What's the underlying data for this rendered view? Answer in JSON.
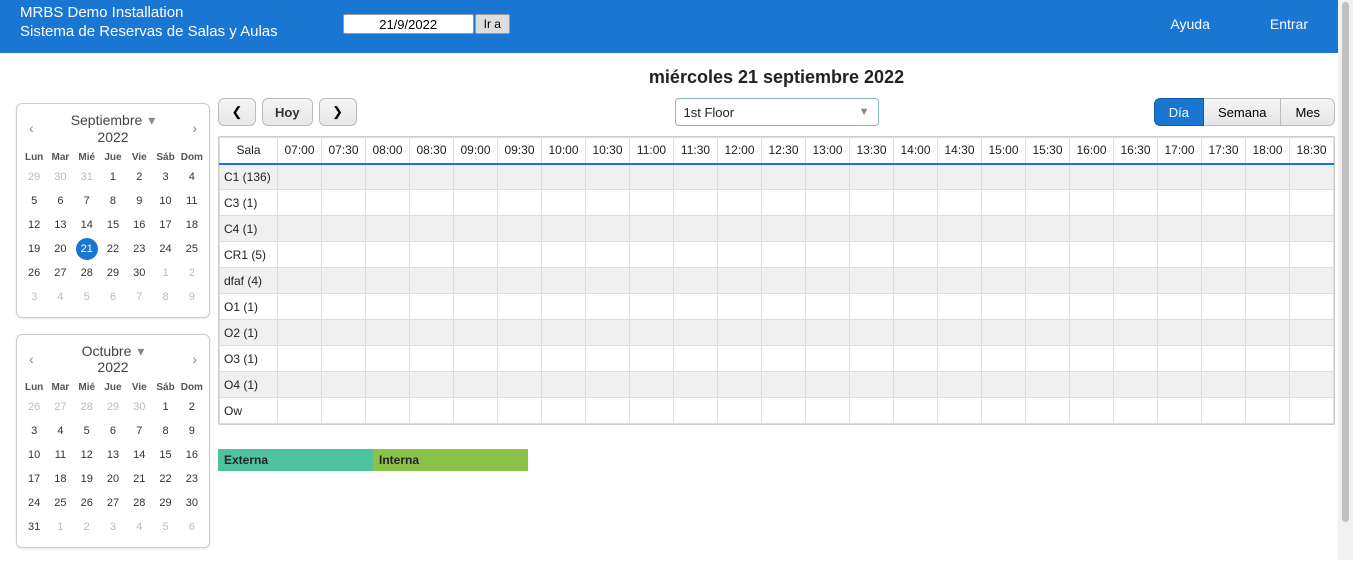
{
  "header": {
    "title_line1": "MRBS Demo Installation",
    "title_line2": "Sistema de Reservas de Salas y Aulas",
    "date_value": "21/9/2022",
    "go_label": "Ir a",
    "help_label": "Ayuda",
    "login_label": "Entrar"
  },
  "page_title": "miércoles 21 septiembre 2022",
  "nav": {
    "prev": "❮",
    "today": "Hoy",
    "next": "❯"
  },
  "floor": {
    "selected": "1st Floor"
  },
  "views": {
    "day": "Día",
    "week": "Semana",
    "month": "Mes"
  },
  "mini1": {
    "month": "Septiembre",
    "year": "2022",
    "dow": [
      "Lun",
      "Mar",
      "Mié",
      "Jue",
      "Vie",
      "Sáb",
      "Dom"
    ],
    "weeks": [
      [
        {
          "d": "29",
          "o": true
        },
        {
          "d": "30",
          "o": true
        },
        {
          "d": "31",
          "o": true
        },
        {
          "d": "1"
        },
        {
          "d": "2"
        },
        {
          "d": "3"
        },
        {
          "d": "4"
        }
      ],
      [
        {
          "d": "5"
        },
        {
          "d": "6"
        },
        {
          "d": "7"
        },
        {
          "d": "8"
        },
        {
          "d": "9"
        },
        {
          "d": "10"
        },
        {
          "d": "11"
        }
      ],
      [
        {
          "d": "12"
        },
        {
          "d": "13"
        },
        {
          "d": "14"
        },
        {
          "d": "15"
        },
        {
          "d": "16"
        },
        {
          "d": "17"
        },
        {
          "d": "18"
        }
      ],
      [
        {
          "d": "19"
        },
        {
          "d": "20"
        },
        {
          "d": "21",
          "sel": true
        },
        {
          "d": "22"
        },
        {
          "d": "23"
        },
        {
          "d": "24"
        },
        {
          "d": "25"
        }
      ],
      [
        {
          "d": "26"
        },
        {
          "d": "27"
        },
        {
          "d": "28"
        },
        {
          "d": "29"
        },
        {
          "d": "30"
        },
        {
          "d": "1",
          "o": true
        },
        {
          "d": "2",
          "o": true
        }
      ],
      [
        {
          "d": "3",
          "o": true
        },
        {
          "d": "4",
          "o": true
        },
        {
          "d": "5",
          "o": true
        },
        {
          "d": "6",
          "o": true
        },
        {
          "d": "7",
          "o": true
        },
        {
          "d": "8",
          "o": true
        },
        {
          "d": "9",
          "o": true
        }
      ]
    ]
  },
  "mini2": {
    "month": "Octubre",
    "year": "2022",
    "dow": [
      "Lun",
      "Mar",
      "Mié",
      "Jue",
      "Vie",
      "Sáb",
      "Dom"
    ],
    "weeks": [
      [
        {
          "d": "26",
          "o": true
        },
        {
          "d": "27",
          "o": true
        },
        {
          "d": "28",
          "o": true
        },
        {
          "d": "29",
          "o": true
        },
        {
          "d": "30",
          "o": true
        },
        {
          "d": "1"
        },
        {
          "d": "2"
        }
      ],
      [
        {
          "d": "3"
        },
        {
          "d": "4"
        },
        {
          "d": "5"
        },
        {
          "d": "6"
        },
        {
          "d": "7"
        },
        {
          "d": "8"
        },
        {
          "d": "9"
        }
      ],
      [
        {
          "d": "10"
        },
        {
          "d": "11"
        },
        {
          "d": "12"
        },
        {
          "d": "13"
        },
        {
          "d": "14"
        },
        {
          "d": "15"
        },
        {
          "d": "16"
        }
      ],
      [
        {
          "d": "17"
        },
        {
          "d": "18"
        },
        {
          "d": "19"
        },
        {
          "d": "20"
        },
        {
          "d": "21"
        },
        {
          "d": "22"
        },
        {
          "d": "23"
        }
      ],
      [
        {
          "d": "24"
        },
        {
          "d": "25"
        },
        {
          "d": "26"
        },
        {
          "d": "27"
        },
        {
          "d": "28"
        },
        {
          "d": "29"
        },
        {
          "d": "30"
        }
      ],
      [
        {
          "d": "31"
        },
        {
          "d": "1",
          "o": true
        },
        {
          "d": "2",
          "o": true
        },
        {
          "d": "3",
          "o": true
        },
        {
          "d": "4",
          "o": true
        },
        {
          "d": "5",
          "o": true
        },
        {
          "d": "6",
          "o": true
        }
      ]
    ]
  },
  "schedule": {
    "room_header": "Sala",
    "times": [
      "07:00",
      "07:30",
      "08:00",
      "08:30",
      "09:00",
      "09:30",
      "10:00",
      "10:30",
      "11:00",
      "11:30",
      "12:00",
      "12:30",
      "13:00",
      "13:30",
      "14:00",
      "14:30",
      "15:00",
      "15:30",
      "16:00",
      "16:30",
      "17:00",
      "17:30",
      "18:00",
      "18:30"
    ],
    "rooms": [
      "C1 (136)",
      "C3 (1)",
      "C4 (1)",
      "CR1 (5)",
      "dfaf (4)",
      "O1 (1)",
      "O2 (1)",
      "O3 (1)",
      "O4 (1)",
      "Ow"
    ]
  },
  "legend": {
    "externa": "Externa",
    "interna": "Interna"
  }
}
